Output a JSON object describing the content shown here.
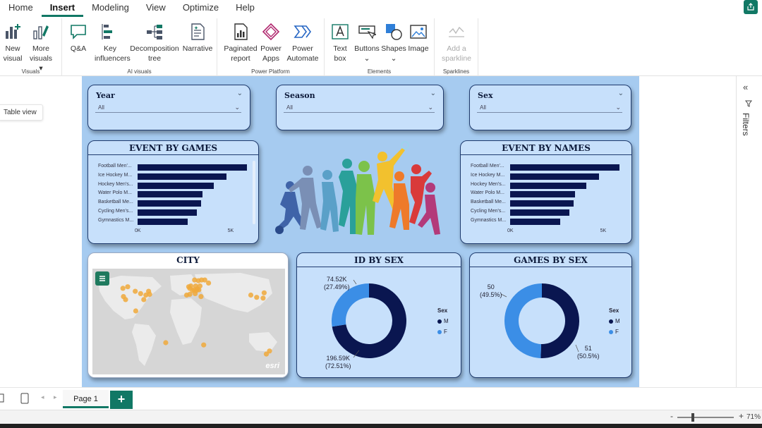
{
  "menu": [
    "Home",
    "Insert",
    "Modeling",
    "View",
    "Optimize",
    "Help"
  ],
  "menu_active": "Insert",
  "ribbon": {
    "visuals": {
      "label": "Visuals",
      "new_visual": [
        "New",
        "visual"
      ],
      "more_visuals": [
        "More",
        "visuals ▾"
      ]
    },
    "ai_visuals": {
      "label": "AI visuals",
      "qa": "Q&A",
      "key_influencers": [
        "Key",
        "influencers"
      ],
      "decomposition_tree": [
        "Decomposition",
        "tree"
      ],
      "narrative": "Narrative"
    },
    "power_platform": {
      "label": "Power Platform",
      "paginated_report": [
        "Paginated",
        "report"
      ],
      "power_apps": [
        "Power",
        "Apps"
      ],
      "power_automate": [
        "Power",
        "Automate"
      ]
    },
    "elements": {
      "label": "Elements",
      "text_box": [
        "Text",
        "box"
      ],
      "buttons": [
        "Buttons",
        "⌄"
      ],
      "shapes": [
        "Shapes",
        "⌄"
      ],
      "image": "Image"
    },
    "sparklines": {
      "label": "Sparklines",
      "add_sparkline": [
        "Add a",
        "sparkline"
      ]
    }
  },
  "left_pane": {
    "tooltip": "Table view"
  },
  "right_pane": {
    "filters_label": "Filters"
  },
  "slicers": [
    {
      "title": "Year",
      "value": "All"
    },
    {
      "title": "Season",
      "value": "All"
    },
    {
      "title": "Sex",
      "value": "All"
    }
  ],
  "event_by_games": {
    "title": "EVENT BY GAMES"
  },
  "event_by_names": {
    "title": "EVENT BY NAMES"
  },
  "city": {
    "title": "CITY",
    "watermark": "esri"
  },
  "id_by_sex": {
    "title": "ID BY SEX"
  },
  "games_by_sex": {
    "title": "GAMES BY SEX"
  },
  "chart_data": [
    {
      "type": "bar",
      "title": "EVENT BY GAMES",
      "categories": [
        "Football Men'...",
        "Ice Hockey M...",
        "Hockey Men's...",
        "Water Polo M...",
        "Basketball Me...",
        "Cycling Men's...",
        "Gymnastics M..."
      ],
      "values": [
        5900,
        4800,
        4100,
        3500,
        3400,
        3200,
        2700
      ],
      "xtick_labels": [
        "0K",
        "5K"
      ],
      "xlim": [
        0,
        6000
      ]
    },
    {
      "type": "bar",
      "title": "EVENT BY NAMES",
      "categories": [
        "Football Men'...",
        "Ice Hockey M...",
        "Hockey Men's...",
        "Water Polo M...",
        "Basketball Me...",
        "Cycling Men's...",
        "Gymnastics M..."
      ],
      "values": [
        5900,
        4800,
        4100,
        3500,
        3400,
        3200,
        2700
      ],
      "xtick_labels": [
        "0K",
        "5K"
      ],
      "xlim": [
        0,
        6000
      ]
    },
    {
      "type": "pie",
      "title": "ID BY SEX",
      "legend_title": "Sex",
      "slices": [
        {
          "name": "M",
          "value": 196590,
          "label": "196.59K",
          "percent_label": "(72.51%)",
          "color": "#0a1650"
        },
        {
          "name": "F",
          "value": 74520,
          "label": "74.52K",
          "percent_label": "(27.49%)",
          "color": "#3b8ee6"
        }
      ]
    },
    {
      "type": "pie",
      "title": "GAMES BY SEX",
      "legend_title": "Sex",
      "slices": [
        {
          "name": "M",
          "value": 51,
          "label": "51",
          "percent_label": "(50.5%)",
          "color": "#0a1650"
        },
        {
          "name": "F",
          "value": 50,
          "label": "50",
          "percent_label": "(49.5%)",
          "color": "#3b8ee6"
        }
      ]
    }
  ],
  "map_points": [
    {
      "lon": -122,
      "lat": 38
    },
    {
      "lon": -118,
      "lat": 34
    },
    {
      "lon": -100,
      "lat": 45
    },
    {
      "lon": -90,
      "lat": 42
    },
    {
      "lon": -80,
      "lat": 40
    },
    {
      "lon": -75,
      "lat": 45
    },
    {
      "lon": -99,
      "lat": 19
    },
    {
      "lon": -114,
      "lat": 51
    },
    {
      "lon": -123,
      "lat": 49
    },
    {
      "lon": -73,
      "lat": 41
    },
    {
      "lon": -84,
      "lat": 34
    },
    {
      "lon": 0,
      "lat": 51
    },
    {
      "lon": 2,
      "lat": 49
    },
    {
      "lon": 13,
      "lat": 52
    },
    {
      "lon": 12,
      "lat": 42
    },
    {
      "lon": 18,
      "lat": 59
    },
    {
      "lon": 24,
      "lat": 60
    },
    {
      "lon": 10,
      "lat": 47
    },
    {
      "lon": 7,
      "lat": 46
    },
    {
      "lon": 16,
      "lat": 48
    },
    {
      "lon": 23,
      "lat": 38
    },
    {
      "lon": 2,
      "lat": 41
    },
    {
      "lon": -4,
      "lat": 40
    },
    {
      "lon": 11,
      "lat": 60
    },
    {
      "lon": 4,
      "lat": 52
    },
    {
      "lon": 37,
      "lat": 56
    },
    {
      "lon": 30,
      "lat": 60
    },
    {
      "lon": 21,
      "lat": 52
    },
    {
      "lon": 19,
      "lat": 47
    },
    {
      "lon": 14,
      "lat": 46
    },
    {
      "lon": 139,
      "lat": 36
    },
    {
      "lon": 127,
      "lat": 37
    },
    {
      "lon": 116,
      "lat": 40
    },
    {
      "lon": 141,
      "lat": 43
    },
    {
      "lon": 151,
      "lat": -34
    },
    {
      "lon": 145,
      "lat": -38
    },
    {
      "lon": 28,
      "lat": -26
    },
    {
      "lon": -43,
      "lat": -23
    }
  ],
  "pages": {
    "current": "Page 1",
    "add": "+"
  },
  "status": {
    "zoom": "71%",
    "zoom_level": 0.71
  }
}
